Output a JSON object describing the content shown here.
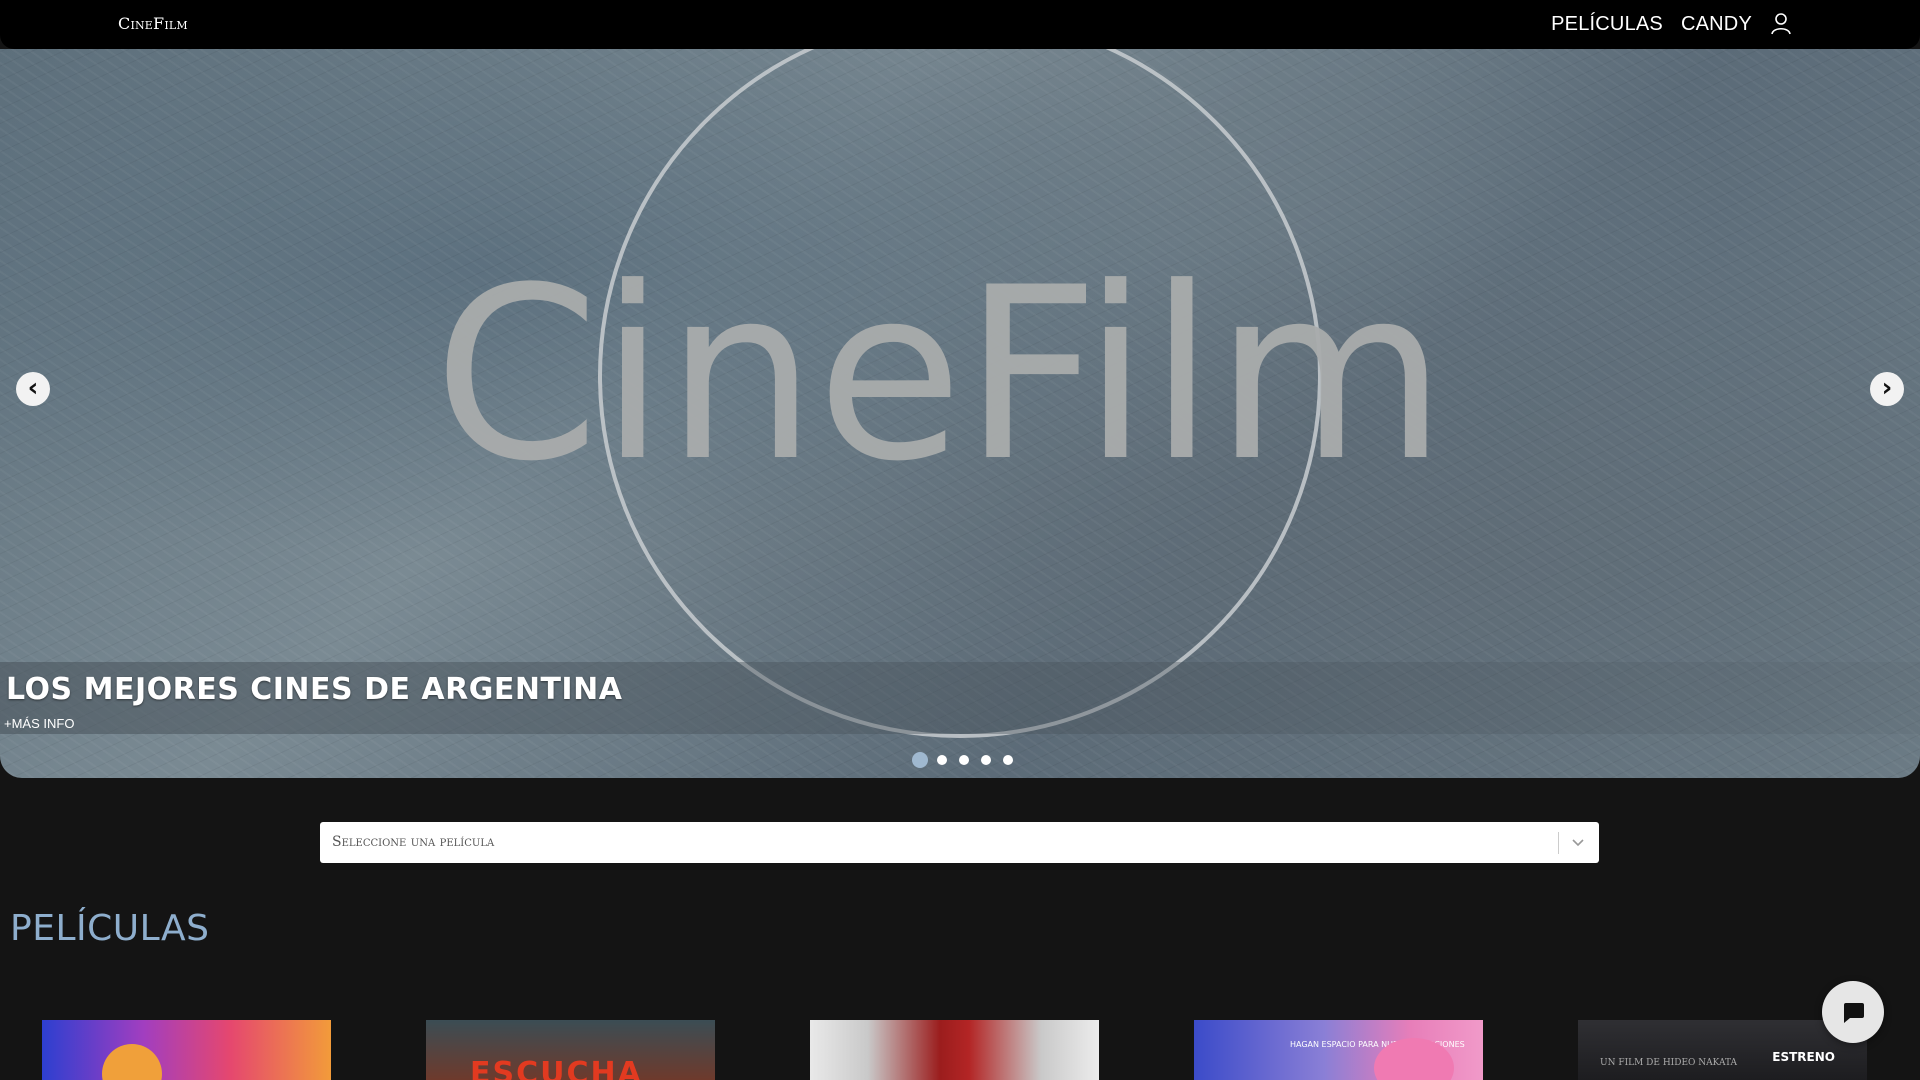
{
  "header": {
    "brand": "CineFilm",
    "nav": [
      "PELÍCULAS",
      "CANDY"
    ],
    "user_icon": "user-icon"
  },
  "hero": {
    "logo_text": "CineFilm",
    "caption_title": "LOS MEJORES CINES DE ARGENTINA",
    "caption_link": "+MÁS INFO",
    "prev_icon": "chevron-left-icon",
    "next_icon": "chevron-right-icon",
    "slides_count": 5,
    "active_slide": 1
  },
  "movie_select": {
    "placeholder": "Seleccione una película",
    "icon": "chevron-down-icon"
  },
  "movies_section": {
    "title": "PELÍCULAS",
    "posters": [
      {
        "id": "poster-1"
      },
      {
        "id": "poster-2",
        "visible_text": "ESCUCHA"
      },
      {
        "id": "poster-3"
      },
      {
        "id": "poster-4",
        "visible_text": "HAGAN ESPACIO PARA NUEVAS EMOCIONES"
      },
      {
        "id": "poster-5",
        "badge": "ESTRENO",
        "visible_text": "UN FILM DE HIDEO NAKATA"
      }
    ]
  },
  "chat_button": {
    "icon": "chat-bubble-icon"
  },
  "colors": {
    "background": "#141414",
    "topbar": "#000000",
    "section_title": "#8eaecd",
    "active_dot": "#9fb8cf"
  }
}
